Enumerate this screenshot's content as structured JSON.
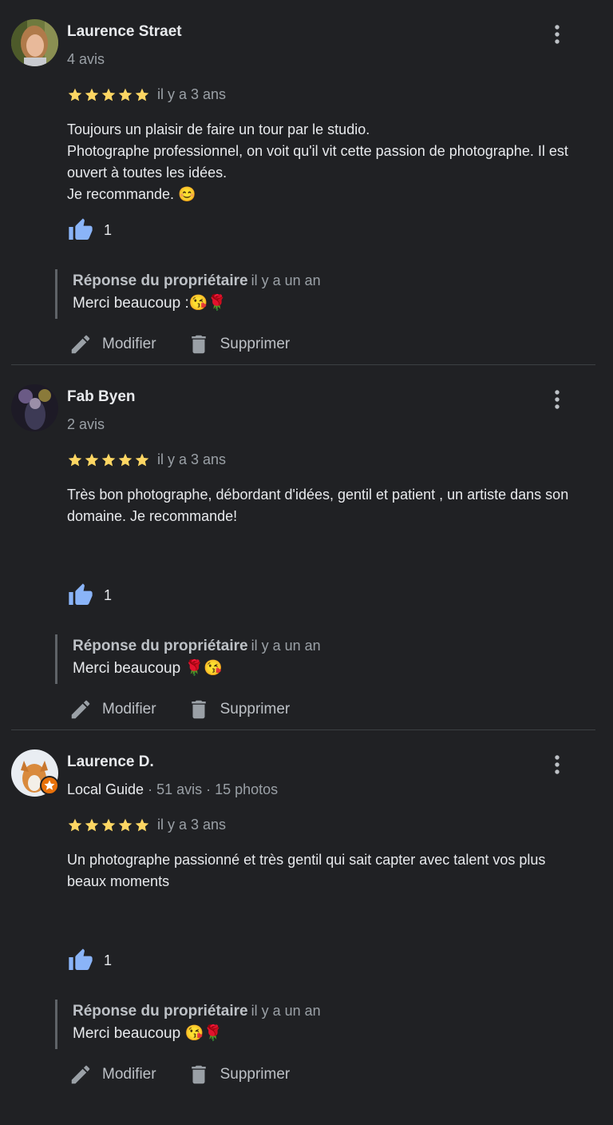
{
  "common": {
    "reply_label": "Réponse du propriétaire",
    "edit_label": "Modifier",
    "delete_label": "Supprimer",
    "star_color": "#fdd663",
    "like_color": "#8ab4f8"
  },
  "reviews": [
    {
      "name": "Laurence Straet",
      "meta": "4 avis",
      "rating": 5,
      "date": "il y a 3 ans",
      "text_lines": [
        "Toujours un plaisir de faire un tour par le studio.",
        "Photographe professionnel, on voit qu'il vit cette passion de photographe. Il est ouvert à toutes les idées.",
        "Je recommande. 😊"
      ],
      "likes": "1",
      "reply_date": "il y a un an",
      "reply_text": "Merci beaucoup :😘🌹"
    },
    {
      "name": "Fab Byen",
      "meta": "2 avis",
      "rating": 5,
      "date": "il y a 3 ans",
      "text_lines": [
        "Très bon photographe, débordant d'idées, gentil et patient , un artiste dans son domaine. Je recommande!"
      ],
      "likes": "1",
      "reply_date": "il y a un an",
      "reply_text": "Merci beaucoup 🌹😘"
    },
    {
      "name": "Laurence D.",
      "meta_guide": "Local Guide",
      "meta": " · 51 avis · 15 photos",
      "rating": 5,
      "date": "il y a 3 ans",
      "text_lines": [
        "Un photographe passionné et très gentil qui sait capter avec talent vos plus beaux moments"
      ],
      "likes": "1",
      "reply_date": "il y a un an",
      "reply_text": "Merci beaucoup 😘🌹"
    }
  ]
}
